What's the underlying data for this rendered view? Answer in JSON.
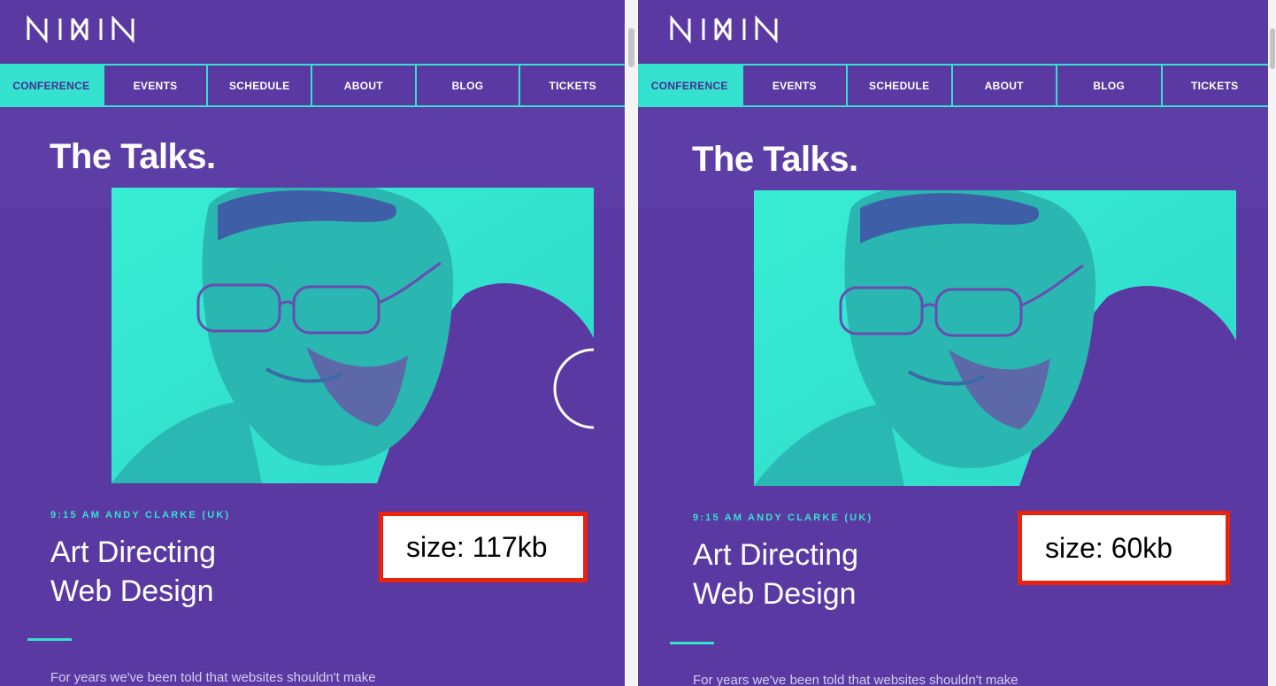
{
  "colors": {
    "purple": "#5a3aa2",
    "teal": "#35e1cf",
    "highlight_red": "#e8240e"
  },
  "panels": [
    {
      "brand_logo": "MIXIN",
      "nav": [
        "CONFERENCE",
        "EVENTS",
        "SCHEDULE",
        "ABOUT",
        "BLOG",
        "TICKETS"
      ],
      "active_nav": "CONFERENCE",
      "title": "The Talks.",
      "speaker_meta": "9:15 AM ANDY CLARKE (UK)",
      "talk_title_line1": "Art Directing",
      "talk_title_line2": "Web Design",
      "size_label": "size: 117kb",
      "body_text": "For years we've been told that websites shouldn't make",
      "photo_icon": "speaker-photo"
    },
    {
      "brand_logo": "MIXIN",
      "nav": [
        "CONFERENCE",
        "EVENTS",
        "SCHEDULE",
        "ABOUT",
        "BLOG",
        "TICKETS"
      ],
      "active_nav": "CONFERENCE",
      "title": "The Talks.",
      "speaker_meta": "9:15 AM ANDY CLARKE (UK)",
      "talk_title_line1": "Art Directing",
      "talk_title_line2": "Web Design",
      "size_label": "size: 60kb",
      "body_text": "For years we've been told that websites shouldn't make",
      "photo_icon": "speaker-photo"
    }
  ]
}
